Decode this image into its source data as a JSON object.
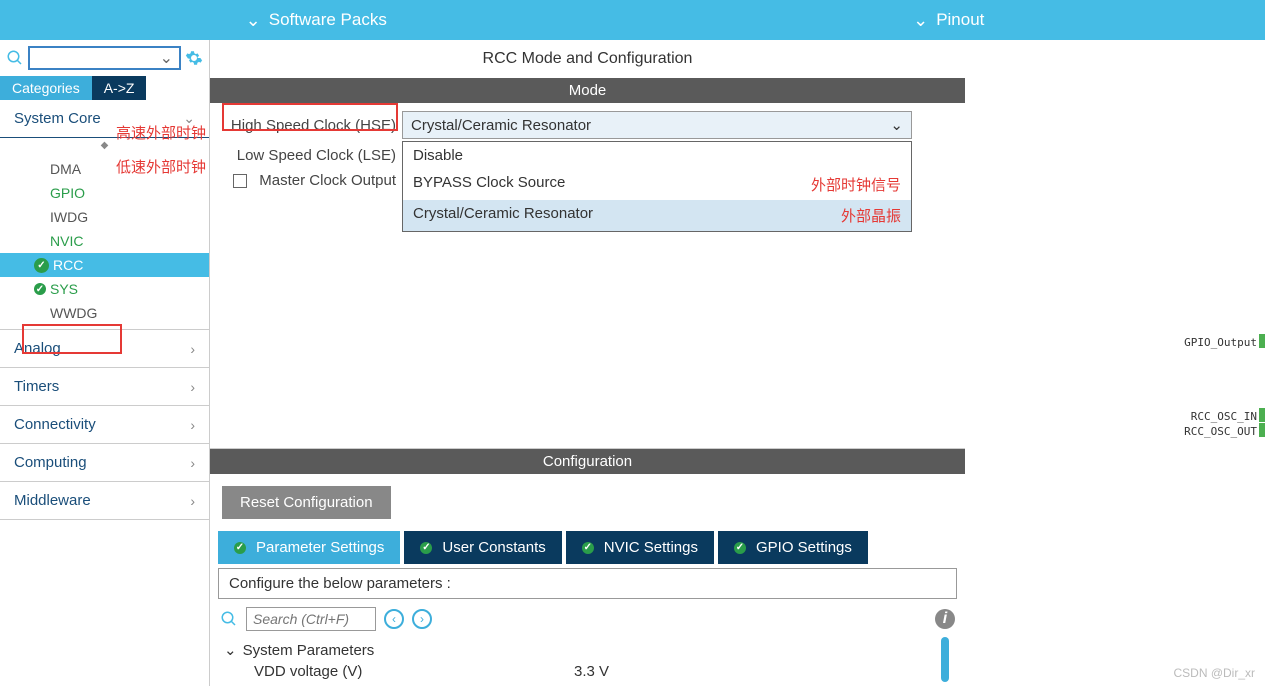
{
  "topbar": {
    "section1": "Software Packs",
    "section2": "Pinout"
  },
  "sidebar": {
    "tabs": {
      "categories": "Categories",
      "az": "A->Z"
    },
    "groups": [
      {
        "name": "System Core",
        "expanded": true,
        "items": [
          {
            "label": "DMA"
          },
          {
            "label": "GPIO",
            "green": true
          },
          {
            "label": "IWDG"
          },
          {
            "label": "NVIC",
            "green": true
          },
          {
            "label": "RCC",
            "green": true,
            "selected": true,
            "check": true
          },
          {
            "label": "SYS",
            "green": true,
            "check": true
          },
          {
            "label": "WWDG"
          }
        ]
      },
      {
        "name": "Analog"
      },
      {
        "name": "Timers"
      },
      {
        "name": "Connectivity"
      },
      {
        "name": "Computing"
      },
      {
        "name": "Middleware"
      }
    ]
  },
  "annotations": {
    "hse_label": "高速外部时钟",
    "lse_label": "低速外部时钟",
    "bypass_note": "外部时钟信号",
    "crystal_note": "外部晶振"
  },
  "center": {
    "title": "RCC Mode and Configuration",
    "mode_header": "Mode",
    "hse_label": "High Speed Clock (HSE)",
    "lse_label": "Low Speed Clock (LSE)",
    "master_clock": "Master Clock Output",
    "hse_value": "Crystal/Ceramic Resonator",
    "dropdown": {
      "opt1": "Disable",
      "opt2": "BYPASS Clock Source",
      "opt3": "Crystal/Ceramic Resonator"
    },
    "config_header": "Configuration",
    "reset_btn": "Reset Configuration",
    "tabs": {
      "param": "Parameter Settings",
      "user": "User Constants",
      "nvic": "NVIC Settings",
      "gpio": "GPIO Settings"
    },
    "config_desc": "Configure the below parameters :",
    "search_placeholder": "Search (Ctrl+F)",
    "param_group": "System Parameters",
    "param1_name": "VDD voltage (V)",
    "param1_value": "3.3 V"
  },
  "right": {
    "pin1": "GPIO_Output",
    "pin2": "RCC_OSC_IN",
    "pin3": "RCC_OSC_OUT"
  },
  "watermark": "CSDN @Dir_xr"
}
